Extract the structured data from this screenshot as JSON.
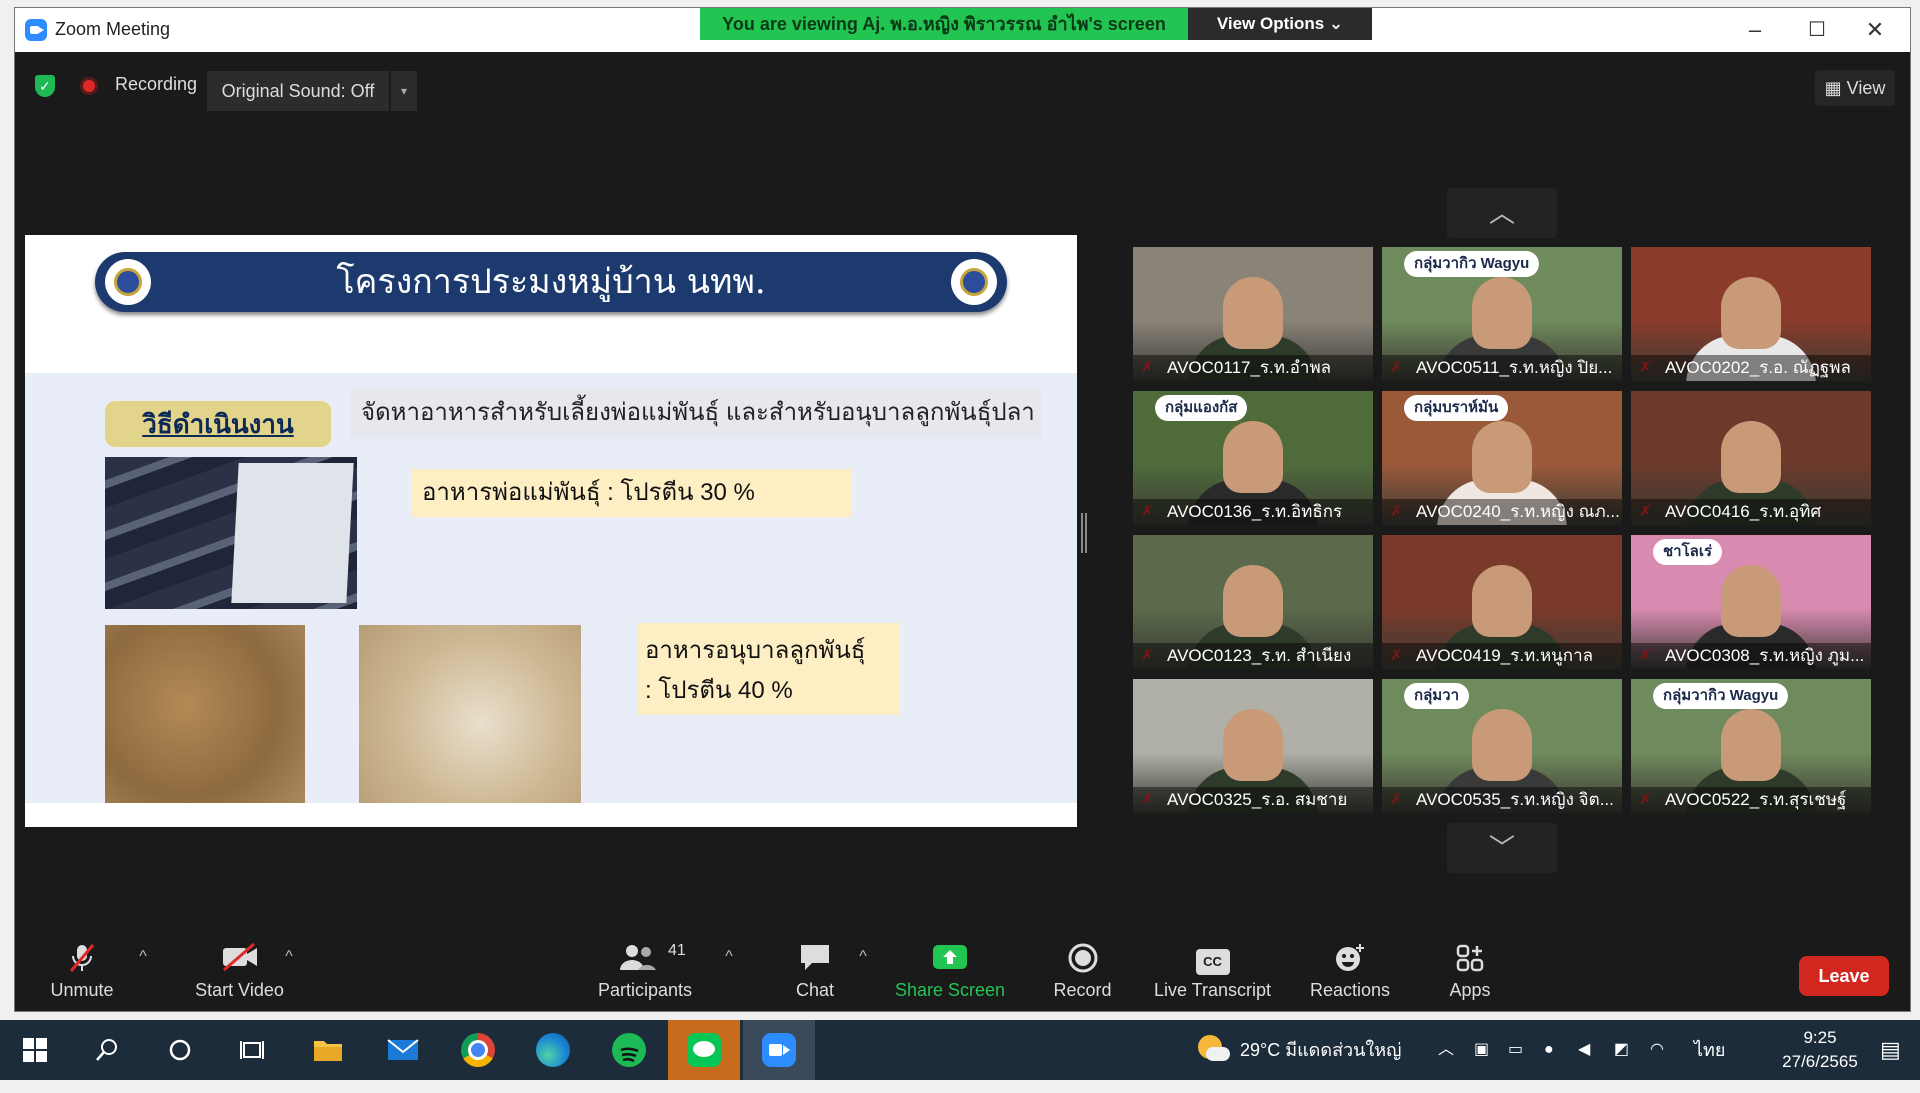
{
  "window": {
    "title": "Zoom Meeting",
    "minimize": "–",
    "maximize": "☐",
    "close": "✕"
  },
  "banner": {
    "text": "You are viewing Aj. พ.อ.หญิง พิราวรรณ  อำไพ's screen",
    "view_options": "View Options ⌄"
  },
  "topbar": {
    "recording": "Recording",
    "original_sound": "Original Sound: Off",
    "dropdown": "▾",
    "view": "View",
    "view_icon": "▦"
  },
  "slide": {
    "title": "โครงการประมงหมู่บ้าน นทพ.",
    "method_label": "วิธีดำเนินงาน",
    "method_desc": "จัดหาอาหารสำหรับเลี้ยงพ่อแม่พันธุ์  และสำหรับอนุบาลลูกพันธุ์ปลา",
    "food1": "อาหารพ่อแม่พันธุ์  :  โปรตีน 30 %",
    "food2_line1": "อาหารอนุบาลลูกพันธุ์",
    "food2_line2": ":  โปรตีน 40 %"
  },
  "gallery": {
    "up": "︿",
    "down": "﹀",
    "participants": [
      {
        "name": "AVOC0117_ร.ท.อำพล",
        "bg": "#8a8378",
        "shirt": "#2e3a2a"
      },
      {
        "name": "AVOC0511_ร.ท.หญิง ปิย...",
        "bg": "#6f8a5c",
        "shirt": "#3a3a3a",
        "overlay": "กลุ่มวากิว Wagyu"
      },
      {
        "name": "AVOC0202_ร.อ. ณัฏฐพล",
        "bg": "#8a3b2a",
        "shirt": "#e8e8e8"
      },
      {
        "name": "AVOC0136_ร.ท.อิทธิกร",
        "bg": "#4f6b3a",
        "shirt": "#2a2a2a",
        "overlay": "กลุ่มแองกัส"
      },
      {
        "name": "AVOC0240_ร.ท.หญิง ณภ...",
        "bg": "#9a5a3a",
        "shirt": "#f0e8e0",
        "overlay": "กลุ่มบราห์มัน"
      },
      {
        "name": "AVOC0416_ร.ท.อุทิศ",
        "bg": "#6b3a2a",
        "shirt": "#2e3a2a"
      },
      {
        "name": "AVOC0123_ร.ท. สำเนียง",
        "bg": "#5a6a4a",
        "shirt": "#2e3a2a"
      },
      {
        "name": "AVOC0419_ร.ท.หนูกาล",
        "bg": "#7a3a2a",
        "shirt": "#2e3a2a"
      },
      {
        "name": "AVOC0308_ร.ท.หญิง ภูม...",
        "bg": "#d88ab0",
        "shirt": "#2a2a2a",
        "overlay": "ชาโลเร่"
      },
      {
        "name": "AVOC0325_ร.อ. สมชาย",
        "bg": "#b0b0a8",
        "shirt": "#2e3a2a"
      },
      {
        "name": "AVOC0535_ร.ท.หญิง จิต...",
        "bg": "#6f8a5c",
        "shirt": "#3a3a3a",
        "overlay": "กลุ่มวา"
      },
      {
        "name": "AVOC0522_ร.ท.สุรเชษฐ์",
        "bg": "#6f8a5c",
        "shirt": "#2e3a2a",
        "overlay": "กลุ่มวากิว Wagyu"
      }
    ]
  },
  "toolbar": {
    "unmute": "Unmute",
    "start_video": "Start Video",
    "participants": "Participants",
    "participants_count": "41",
    "chat": "Chat",
    "share_screen": "Share Screen",
    "record": "Record",
    "live_transcript": "Live Transcript",
    "reactions": "Reactions",
    "apps": "Apps",
    "leave": "Leave",
    "caret": "^",
    "cc": "CC"
  },
  "taskbar": {
    "weather": "29°C  มีแดดส่วนใหญ่",
    "lang": "ไทย",
    "time": "9:25",
    "date": "27/6/2565"
  },
  "colors": {
    "accent_green": "#23c552",
    "leave_red": "#d2271f",
    "zoom_blue": "#2d8cff"
  }
}
